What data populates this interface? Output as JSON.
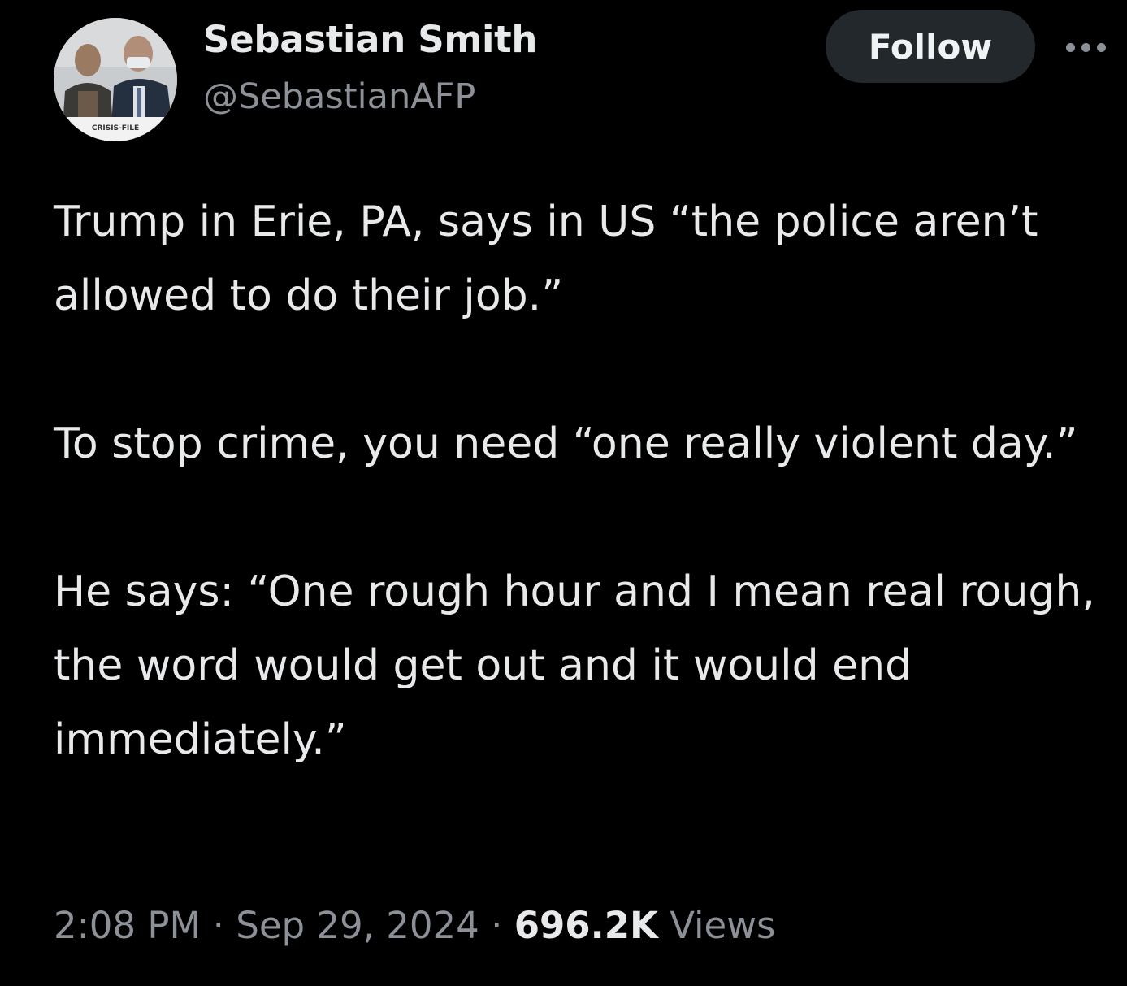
{
  "author": {
    "display_name": "Sebastian Smith",
    "handle": "@SebastianAFP",
    "avatar_caption": "CRISIS-FILE"
  },
  "follow_button": {
    "label": "Follow"
  },
  "more_menu": {
    "icon": "more-horizontal-icon"
  },
  "tweet": {
    "paragraphs": [
      "Trump in Erie, PA, says in US “the police aren’t allowed to do their job.”",
      "To stop crime, you need “one really violent day.”",
      "He says: “One rough hour and I mean real rough, the word would get out and it would end immediately.”"
    ]
  },
  "meta": {
    "time": "2:08 PM",
    "separator1": " · ",
    "date": "Sep 29, 2024",
    "separator2": " · ",
    "views_count": "696.2K",
    "views_label": " Views"
  },
  "colors": {
    "background": "#000000",
    "primary_text": "#e7e9ea",
    "secondary_text": "#8b9197",
    "follow_button_bg": "#23282c"
  }
}
